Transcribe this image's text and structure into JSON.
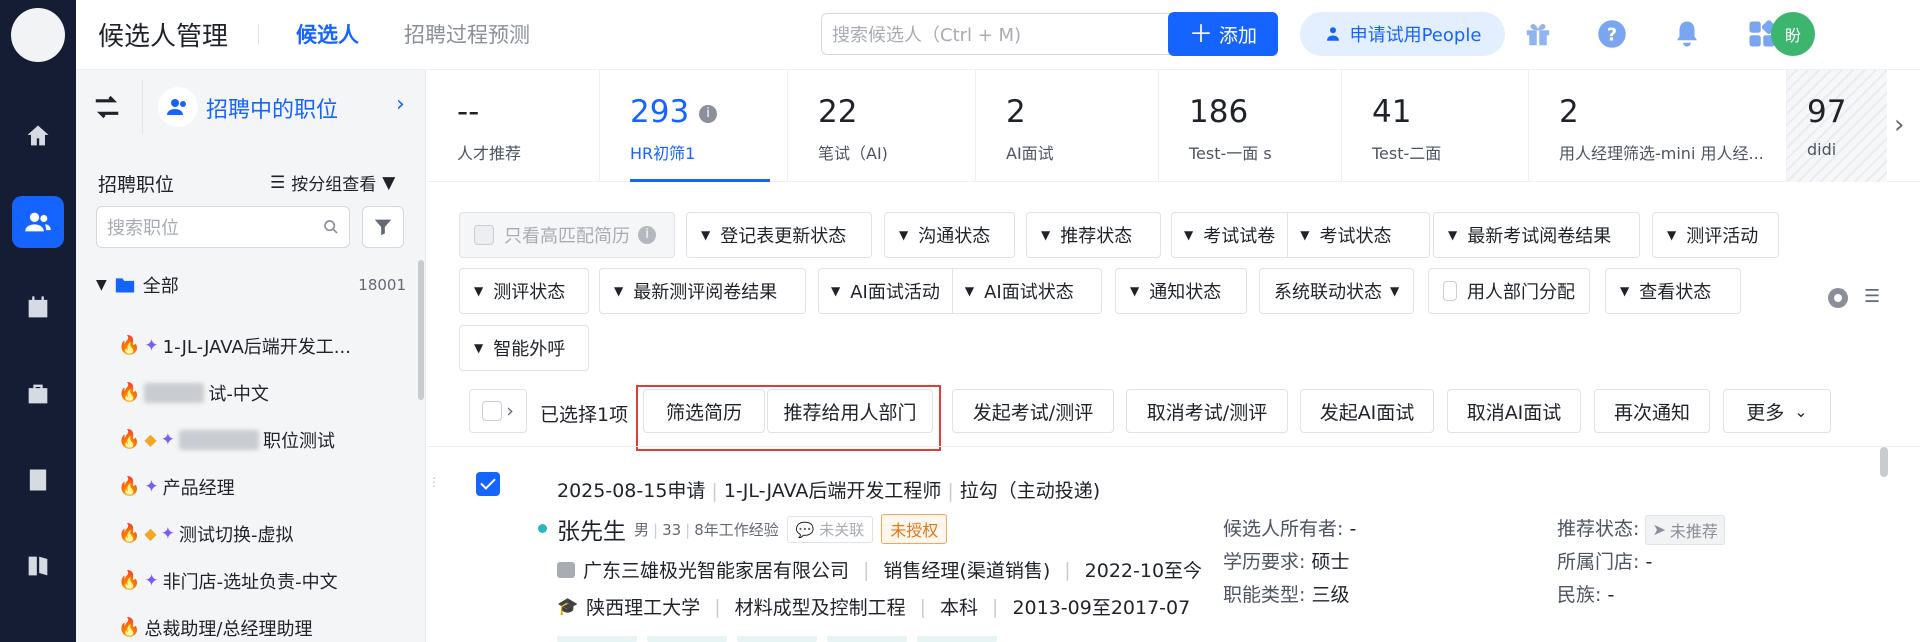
{
  "topbar": {
    "title": "候选人管理",
    "tabs": [
      {
        "label": "候选人",
        "active": true
      },
      {
        "label": "招聘过程预测",
        "active": false
      }
    ],
    "search_placeholder": "搜索候选人（Ctrl + M)",
    "add_label": "添加",
    "trial_label": "申请试用People",
    "user_initial": "盼"
  },
  "rail": {
    "items": [
      "home-icon",
      "candidates-icon",
      "calendar-icon",
      "briefcase-icon",
      "report-icon",
      "book-icon"
    ]
  },
  "sidebar": {
    "header_label": "招聘中的职位",
    "section_title": "招聘职位",
    "group_by": "按分组查看",
    "search_placeholder": "搜索职位",
    "all_label": "全部",
    "all_count": "18001",
    "jobs": [
      {
        "label": "1-JL-JAVA后端开发工..."
      },
      {
        "label": "试-中文"
      },
      {
        "label": "职位测试"
      },
      {
        "label": "产品经理"
      },
      {
        "label": "测试切换-虚拟"
      },
      {
        "label": "非门店-选址负责-中文"
      },
      {
        "label": "总裁助理/总经理助理"
      }
    ]
  },
  "stages": [
    {
      "num": "--",
      "name": "人才推荐"
    },
    {
      "num": "293",
      "name": "HR初筛1"
    },
    {
      "num": "22",
      "name": "笔试（AI)"
    },
    {
      "num": "2",
      "name": "AI面试"
    },
    {
      "num": "186",
      "name": "Test-一面 s"
    },
    {
      "num": "41",
      "name": "Test-二面"
    },
    {
      "num": "2",
      "name": "用人经理筛选-mini 用人经..."
    },
    {
      "num": "97",
      "name": "didi"
    }
  ],
  "filters": {
    "high_match": "只看高匹配简历",
    "row1": [
      "登记表更新状态",
      "沟通状态",
      "推荐状态",
      "考试试卷",
      "考试状态",
      "最新考试阅卷结果",
      "测评活动"
    ],
    "row2": [
      "测评状态",
      "最新测评阅卷结果",
      "AI面试活动",
      "AI面试状态",
      "通知状态",
      "系统联动状态",
      "用人部门分配",
      "查看状态"
    ],
    "row3": [
      "智能外呼"
    ]
  },
  "actions": {
    "selected": "已选择1项",
    "buttons": [
      "筛选简历",
      "推荐给用人部门",
      "发起考试/测评",
      "取消考试/测评",
      "发起AI面试",
      "取消AI面试",
      "再次通知",
      "更多"
    ]
  },
  "candidate": {
    "apply_date": "2025-08-15申请",
    "job": "1-JL-JAVA后端开发工程师",
    "source": "拉勾（主动投递)",
    "name": "张先生",
    "gender": "男",
    "age": "33",
    "experience": "8年工作经验",
    "unlinked": "未关联",
    "unauthorized": "未授权",
    "company": "广东三雄极光智能家居有限公司",
    "position": "销售经理(渠道销售)",
    "period": "2022-10至今",
    "school": "陕西理工大学",
    "major": "材料成型及控制工程",
    "degree": "本科",
    "study_period": "2013-09至2017-07",
    "owner_k": "候选人所有者:",
    "owner_v": "-",
    "edu_k": "学历要求:",
    "edu_v": "硕士",
    "func_k": "职能类型:",
    "func_v": "三级",
    "rec_k": "推荐状态:",
    "rec_v": "未推荐",
    "store_k": "所属门店:",
    "store_v": "-",
    "nation_k": "民族:",
    "nation_v": "-"
  }
}
